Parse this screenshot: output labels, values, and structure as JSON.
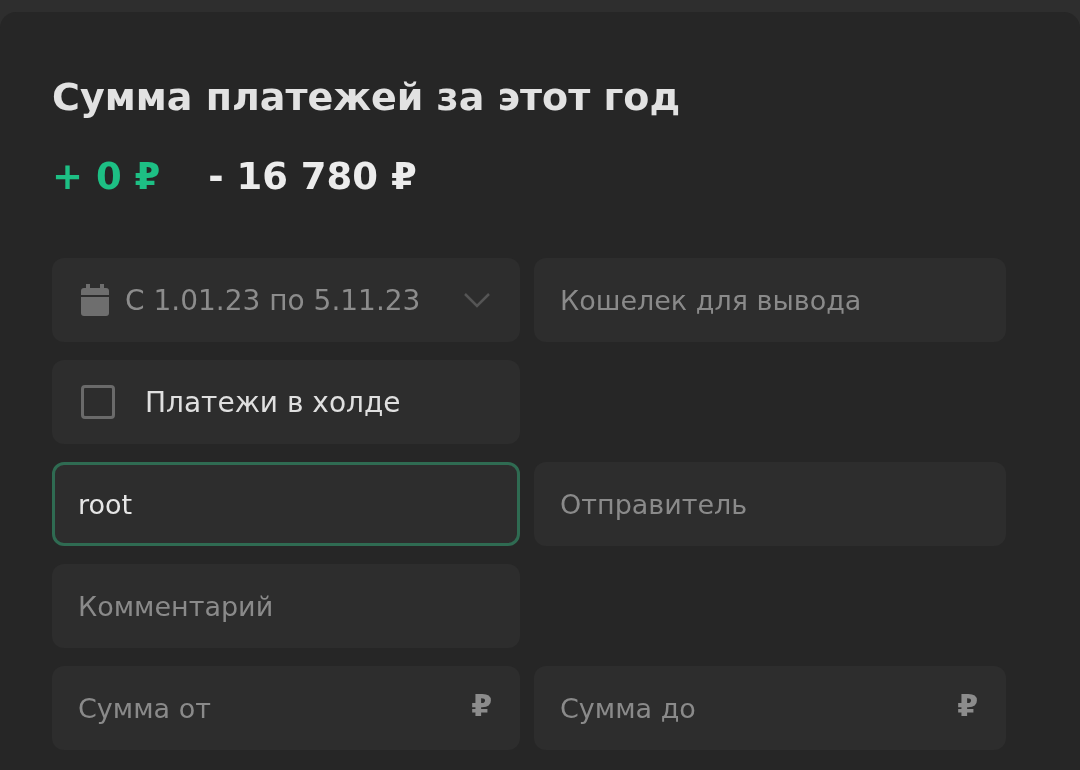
{
  "title": "Сумма платежей за этот год",
  "totals": {
    "income": "+ 0 ₽",
    "expense": "- 16 780 ₽"
  },
  "rows": [
    [
      {
        "kind": "date",
        "value": "С 1.01.23 по 5.11.23"
      },
      {
        "kind": "text",
        "placeholder": "Кошелек для вывода",
        "focused": false
      }
    ],
    [
      {
        "kind": "checkbox",
        "label": "Платежи в холде",
        "checked": false
      }
    ],
    [
      {
        "kind": "text",
        "value": "root",
        "focused": true
      },
      {
        "kind": "text",
        "placeholder": "Отправитель",
        "focused": false
      }
    ],
    [
      {
        "kind": "text",
        "placeholder": "Комментарий",
        "focused": false
      }
    ],
    [
      {
        "kind": "money",
        "placeholder": "Сумма от",
        "currency": "₽",
        "focused": false
      },
      {
        "kind": "money",
        "placeholder": "Сумма до",
        "currency": "₽",
        "focused": false
      }
    ]
  ]
}
